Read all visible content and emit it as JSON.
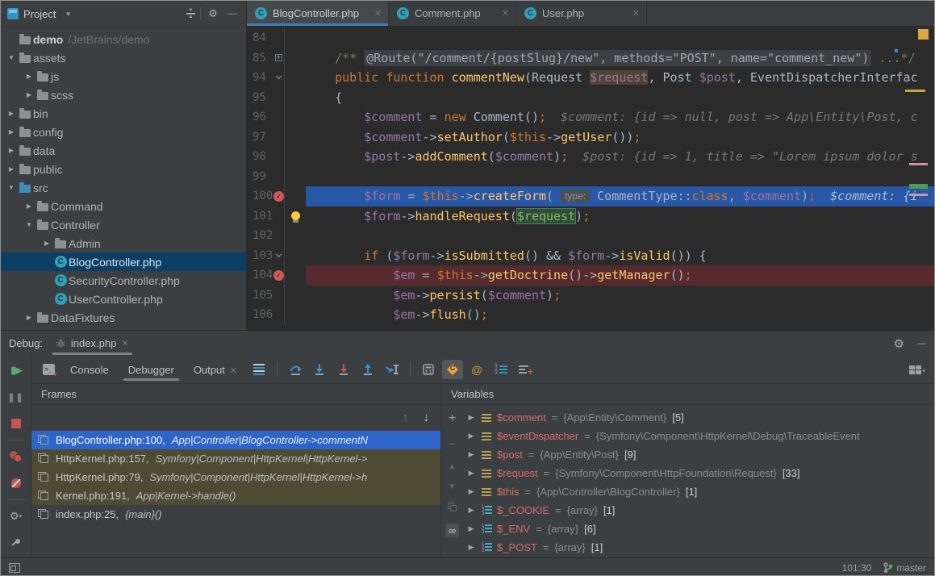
{
  "icons": {
    "gear": "⚙",
    "close": "✕",
    "minus": "—",
    "chevron-down": "▾",
    "collapsed": "▶",
    "expanded": "▼",
    "up-arrow": "↑",
    "down-arrow": "↓",
    "plus": "+",
    "minus-sign": "−",
    "triangle-up": "▲",
    "triangle-down": "▼",
    "infinity": "∞",
    "check": "✓",
    "pause": "❚❚",
    "resume": "▮▶",
    "at": "@"
  },
  "project": {
    "title": "Project",
    "tree": [
      {
        "label": "demo",
        "suffix": "/JetBrains/demo",
        "level": 0,
        "icon": "folder",
        "chev": "",
        "bold": true
      },
      {
        "label": "assets",
        "level": 0,
        "icon": "folder",
        "chev": "expanded"
      },
      {
        "label": "js",
        "level": 1,
        "icon": "folder",
        "chev": "collapsed"
      },
      {
        "label": "scss",
        "level": 1,
        "icon": "folder",
        "chev": "collapsed"
      },
      {
        "label": "bin",
        "level": 0,
        "icon": "folder",
        "chev": "collapsed"
      },
      {
        "label": "config",
        "level": 0,
        "icon": "folder",
        "chev": "collapsed"
      },
      {
        "label": "data",
        "level": 0,
        "icon": "folder",
        "chev": "collapsed"
      },
      {
        "label": "public",
        "level": 0,
        "icon": "folder",
        "chev": "collapsed"
      },
      {
        "label": "src",
        "level": 0,
        "icon": "folder-src",
        "chev": "expanded"
      },
      {
        "label": "Command",
        "level": 1,
        "icon": "folder",
        "chev": "collapsed"
      },
      {
        "label": "Controller",
        "level": 1,
        "icon": "folder",
        "chev": "expanded"
      },
      {
        "label": "Admin",
        "level": 2,
        "icon": "folder",
        "chev": "collapsed"
      },
      {
        "label": "BlogController.php",
        "level": 2,
        "icon": "class",
        "chev": "",
        "selected": true
      },
      {
        "label": "SecurityController.php",
        "level": 2,
        "icon": "class",
        "chev": ""
      },
      {
        "label": "UserController.php",
        "level": 2,
        "icon": "class",
        "chev": ""
      },
      {
        "label": "DataFixtures",
        "level": 1,
        "icon": "folder",
        "chev": "collapsed"
      }
    ]
  },
  "editor": {
    "tabs": [
      {
        "label": "BlogController.php",
        "active": true
      },
      {
        "label": "Comment.php",
        "active": false
      },
      {
        "label": "User.php",
        "active": false
      }
    ],
    "lines": [
      {
        "n": 84,
        "seg": []
      },
      {
        "n": 85,
        "fold": "plus",
        "seg": [
          {
            "c": "cm",
            "t": "    /** "
          },
          {
            "c": "fold",
            "t": "@Route(\"/comment/{postSlug}/new\", methods=\"POST\", name=\"comment_new\")"
          },
          {
            "c": "cm",
            "t": " ...*/"
          }
        ]
      },
      {
        "n": 94,
        "fold": "down",
        "seg": [
          {
            "c": "p",
            "t": "    "
          },
          {
            "c": "k",
            "t": "public function "
          },
          {
            "c": "f",
            "t": "commentNew"
          },
          {
            "c": "p",
            "t": "(Request "
          },
          {
            "c": "vh",
            "t": "$request"
          },
          {
            "c": "p",
            "t": ", Post "
          },
          {
            "c": "v",
            "t": "$post"
          },
          {
            "c": "p",
            "t": ", EventDispatcherInterfac"
          }
        ]
      },
      {
        "n": 95,
        "seg": [
          {
            "c": "p",
            "t": "    {"
          }
        ]
      },
      {
        "n": 96,
        "seg": [
          {
            "c": "p",
            "t": "        "
          },
          {
            "c": "v",
            "t": "$comment"
          },
          {
            "c": "p",
            "t": " = "
          },
          {
            "c": "k",
            "t": "new "
          },
          {
            "c": "p",
            "t": "Comment()"
          },
          {
            "c": "k",
            "t": ";"
          },
          {
            "c": "hint",
            "t": "  $comment: {id => null, post => App\\Entity\\Post, c"
          }
        ]
      },
      {
        "n": 97,
        "seg": [
          {
            "c": "p",
            "t": "        "
          },
          {
            "c": "v",
            "t": "$comment"
          },
          {
            "c": "p",
            "t": "->"
          },
          {
            "c": "f",
            "t": "setAuthor"
          },
          {
            "c": "p",
            "t": "("
          },
          {
            "c": "k",
            "t": "$this"
          },
          {
            "c": "p",
            "t": "->"
          },
          {
            "c": "f",
            "t": "getUser"
          },
          {
            "c": "p",
            "t": "())"
          },
          {
            "c": "k",
            "t": ";"
          }
        ]
      },
      {
        "n": 98,
        "seg": [
          {
            "c": "p",
            "t": "        "
          },
          {
            "c": "v",
            "t": "$post"
          },
          {
            "c": "p",
            "t": "->"
          },
          {
            "c": "f",
            "t": "addComment"
          },
          {
            "c": "p",
            "t": "("
          },
          {
            "c": "v",
            "t": "$comment"
          },
          {
            "c": "p",
            "t": ")"
          },
          {
            "c": "k",
            "t": ";"
          },
          {
            "c": "hint",
            "t": "  $post: {id => 1, title => \"Lorem ipsum dolor s"
          }
        ]
      },
      {
        "n": 99,
        "seg": []
      },
      {
        "n": 100,
        "bp": true,
        "hl": "exec",
        "seg": [
          {
            "c": "p",
            "t": "        "
          },
          {
            "c": "v",
            "t": "$form"
          },
          {
            "c": "p",
            "t": " = "
          },
          {
            "c": "k",
            "t": "$this"
          },
          {
            "c": "p",
            "t": "->"
          },
          {
            "c": "f",
            "t": "createForm"
          },
          {
            "c": "p",
            "t": "( "
          },
          {
            "c": "ph",
            "t": "type:"
          },
          {
            "c": "p",
            "t": " CommentType::"
          },
          {
            "c": "k",
            "t": "class"
          },
          {
            "c": "p",
            "t": ", "
          },
          {
            "c": "v",
            "t": "$comment"
          },
          {
            "c": "p",
            "t": ")"
          },
          {
            "c": "k",
            "t": ";"
          },
          {
            "c": "hint",
            "t": "  $comment: {i"
          }
        ]
      },
      {
        "n": 101,
        "bulb": true,
        "seg": [
          {
            "c": "p",
            "t": "        "
          },
          {
            "c": "v",
            "t": "$form"
          },
          {
            "c": "p",
            "t": "->"
          },
          {
            "c": "f",
            "t": "handleRequest"
          },
          {
            "c": "p",
            "t": "("
          },
          {
            "c": "sel",
            "t": "$request"
          },
          {
            "c": "p",
            "t": ")"
          },
          {
            "c": "k",
            "t": ";"
          }
        ]
      },
      {
        "n": 102,
        "seg": []
      },
      {
        "n": 103,
        "fold": "down",
        "seg": [
          {
            "c": "p",
            "t": "        "
          },
          {
            "c": "k",
            "t": "if"
          },
          {
            "c": "p",
            "t": " ("
          },
          {
            "c": "v",
            "t": "$form"
          },
          {
            "c": "p",
            "t": "->"
          },
          {
            "c": "f",
            "t": "isSubmitted"
          },
          {
            "c": "p",
            "t": "() && "
          },
          {
            "c": "v",
            "t": "$form"
          },
          {
            "c": "p",
            "t": "->"
          },
          {
            "c": "f",
            "t": "isValid"
          },
          {
            "c": "p",
            "t": "()) {"
          }
        ]
      },
      {
        "n": 104,
        "bp": true,
        "hl": "bp",
        "seg": [
          {
            "c": "p",
            "t": "            "
          },
          {
            "c": "v",
            "t": "$em"
          },
          {
            "c": "p",
            "t": " = "
          },
          {
            "c": "k",
            "t": "$this"
          },
          {
            "c": "p",
            "t": "->"
          },
          {
            "c": "f",
            "t": "getDoctrine"
          },
          {
            "c": "p",
            "t": "()->"
          },
          {
            "c": "f",
            "t": "getManager"
          },
          {
            "c": "p",
            "t": "()"
          },
          {
            "c": "k",
            "t": ";"
          }
        ]
      },
      {
        "n": 105,
        "seg": [
          {
            "c": "p",
            "t": "            "
          },
          {
            "c": "v",
            "t": "$em"
          },
          {
            "c": "p",
            "t": "->"
          },
          {
            "c": "f",
            "t": "persist"
          },
          {
            "c": "p",
            "t": "("
          },
          {
            "c": "v",
            "t": "$comment"
          },
          {
            "c": "p",
            "t": ")"
          },
          {
            "c": "k",
            "t": ";"
          }
        ]
      },
      {
        "n": 106,
        "seg": [
          {
            "c": "p",
            "t": "            "
          },
          {
            "c": "v",
            "t": "$em"
          },
          {
            "c": "p",
            "t": "->"
          },
          {
            "c": "f",
            "t": "flush"
          },
          {
            "c": "p",
            "t": "()"
          },
          {
            "c": "k",
            "t": ";"
          }
        ]
      }
    ]
  },
  "debug": {
    "label": "Debug:",
    "session_tab": "index.php",
    "tabs": [
      {
        "label": "Console",
        "active": false,
        "closable": false
      },
      {
        "label": "Debugger",
        "active": true,
        "closable": false
      },
      {
        "label": "Output",
        "active": false,
        "closable": true
      }
    ],
    "frames": {
      "title": "Frames",
      "rows": [
        {
          "file": "BlogController.php:100,",
          "method": "App|Controller|BlogController->commentN",
          "state": "sel"
        },
        {
          "file": "HttpKernel.php:157,",
          "method": "Symfony|Component|HttpKernel|HttpKernel->",
          "state": "lib"
        },
        {
          "file": "HttpKernel.php:79,",
          "method": "Symfony|Component|HttpKernel|HttpKernel->h",
          "state": "lib"
        },
        {
          "file": "Kernel.php:191,",
          "method": "App|Kernel->handle()",
          "state": "lib"
        },
        {
          "file": "index.php:25,",
          "method": "{main}()",
          "state": ""
        }
      ]
    },
    "variables": {
      "title": "Variables",
      "rows": [
        {
          "name": "$comment",
          "value": "{App\\Entity\\Comment}",
          "count": "[5]",
          "kind": "obj"
        },
        {
          "name": "$eventDispatcher",
          "value": "{Symfony\\Component\\HttpKernel\\Debug\\TraceableEvent",
          "count": "",
          "kind": "obj"
        },
        {
          "name": "$post",
          "value": "{App\\Entity\\Post}",
          "count": "[9]",
          "kind": "obj"
        },
        {
          "name": "$request",
          "value": "{Symfony\\Component\\HttpFoundation\\Request}",
          "count": "[33]",
          "kind": "obj"
        },
        {
          "name": "$this",
          "value": "{App\\Controller\\BlogController}",
          "count": "[1]",
          "kind": "obj"
        },
        {
          "name": "$_COOKIE",
          "value": "{array}",
          "count": "[1]",
          "kind": "arr"
        },
        {
          "name": "$_ENV",
          "value": "{array}",
          "count": "[6]",
          "kind": "arr"
        },
        {
          "name": "$_POST",
          "value": "{array}",
          "count": "[1]",
          "kind": "arr"
        }
      ]
    }
  },
  "status_bar": {
    "caret_position": "101:30",
    "branch": "master"
  }
}
